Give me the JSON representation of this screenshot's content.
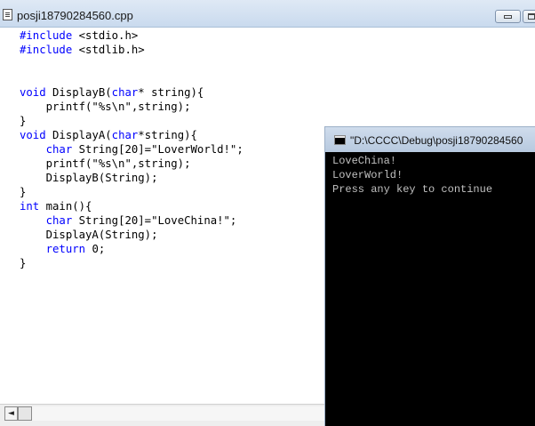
{
  "editor": {
    "title": "posji18790284560.cpp",
    "code_lines": [
      [
        {
          "t": "#include",
          "k": true
        },
        {
          "t": " <stdio.h>",
          "k": false
        }
      ],
      [
        {
          "t": "#include",
          "k": true
        },
        {
          "t": " <stdlib.h>",
          "k": false
        }
      ],
      [],
      [],
      [
        {
          "t": "void",
          "k": true
        },
        {
          "t": " DisplayB(",
          "k": false
        },
        {
          "t": "char",
          "k": true
        },
        {
          "t": "* string){",
          "k": false
        }
      ],
      [
        {
          "t": "    printf(\"%s\\n\",string);",
          "k": false
        }
      ],
      [
        {
          "t": "}",
          "k": false
        }
      ],
      [
        {
          "t": "void",
          "k": true
        },
        {
          "t": " DisplayA(",
          "k": false
        },
        {
          "t": "char",
          "k": true
        },
        {
          "t": "*string){",
          "k": false
        }
      ],
      [
        {
          "t": "    ",
          "k": false
        },
        {
          "t": "char",
          "k": true
        },
        {
          "t": " String[20]=\"LoverWorld!\";",
          "k": false
        }
      ],
      [
        {
          "t": "    printf(\"%s\\n\",string);",
          "k": false
        }
      ],
      [
        {
          "t": "    DisplayB(String);",
          "k": false
        }
      ],
      [
        {
          "t": "}",
          "k": false
        }
      ],
      [
        {
          "t": "int",
          "k": true
        },
        {
          "t": " main(){",
          "k": false
        }
      ],
      [
        {
          "t": "    ",
          "k": false
        },
        {
          "t": "char",
          "k": true
        },
        {
          "t": " String[20]=\"LoveChina!\";",
          "k": false
        }
      ],
      [
        {
          "t": "    DisplayA(String);",
          "k": false
        }
      ],
      [
        {
          "t": "    ",
          "k": false
        },
        {
          "t": "return",
          "k": true
        },
        {
          "t": " 0;",
          "k": false
        }
      ],
      [
        {
          "t": "}",
          "k": false
        }
      ]
    ],
    "scroll_left_arrow": "◄"
  },
  "console": {
    "title": "\"D:\\CCCC\\Debug\\posji18790284560",
    "output_lines": [
      "LoveChina!",
      "LoverWorld!",
      "Press any key to continue"
    ]
  },
  "colors": {
    "keyword": "#0000ff",
    "console_bg": "#000000",
    "console_text": "#c0c0c0"
  }
}
